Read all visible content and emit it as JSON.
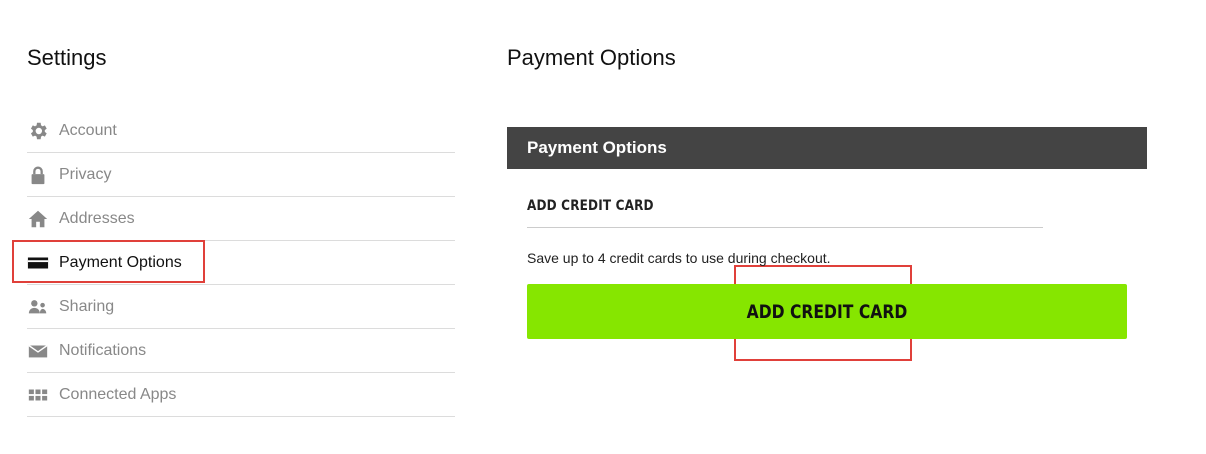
{
  "sidebar": {
    "title": "Settings",
    "items": [
      {
        "label": "Account",
        "icon": "gear-icon",
        "active": false
      },
      {
        "label": "Privacy",
        "icon": "lock-icon",
        "active": false
      },
      {
        "label": "Addresses",
        "icon": "home-icon",
        "active": false
      },
      {
        "label": "Payment Options",
        "icon": "credit-card-icon",
        "active": true
      },
      {
        "label": "Sharing",
        "icon": "users-icon",
        "active": false
      },
      {
        "label": "Notifications",
        "icon": "envelope-icon",
        "active": false
      },
      {
        "label": "Connected Apps",
        "icon": "grid-icon",
        "active": false
      }
    ]
  },
  "main": {
    "title": "Payment Options",
    "panel_header": "Payment Options",
    "section_title": "ADD CREDIT CARD",
    "help_text": "Save up to 4 credit cards to use during checkout.",
    "add_button_label": "ADD CREDIT CARD"
  },
  "colors": {
    "accent_green": "#86e600",
    "header_bg": "#444444",
    "highlight_red": "#e0403a"
  }
}
